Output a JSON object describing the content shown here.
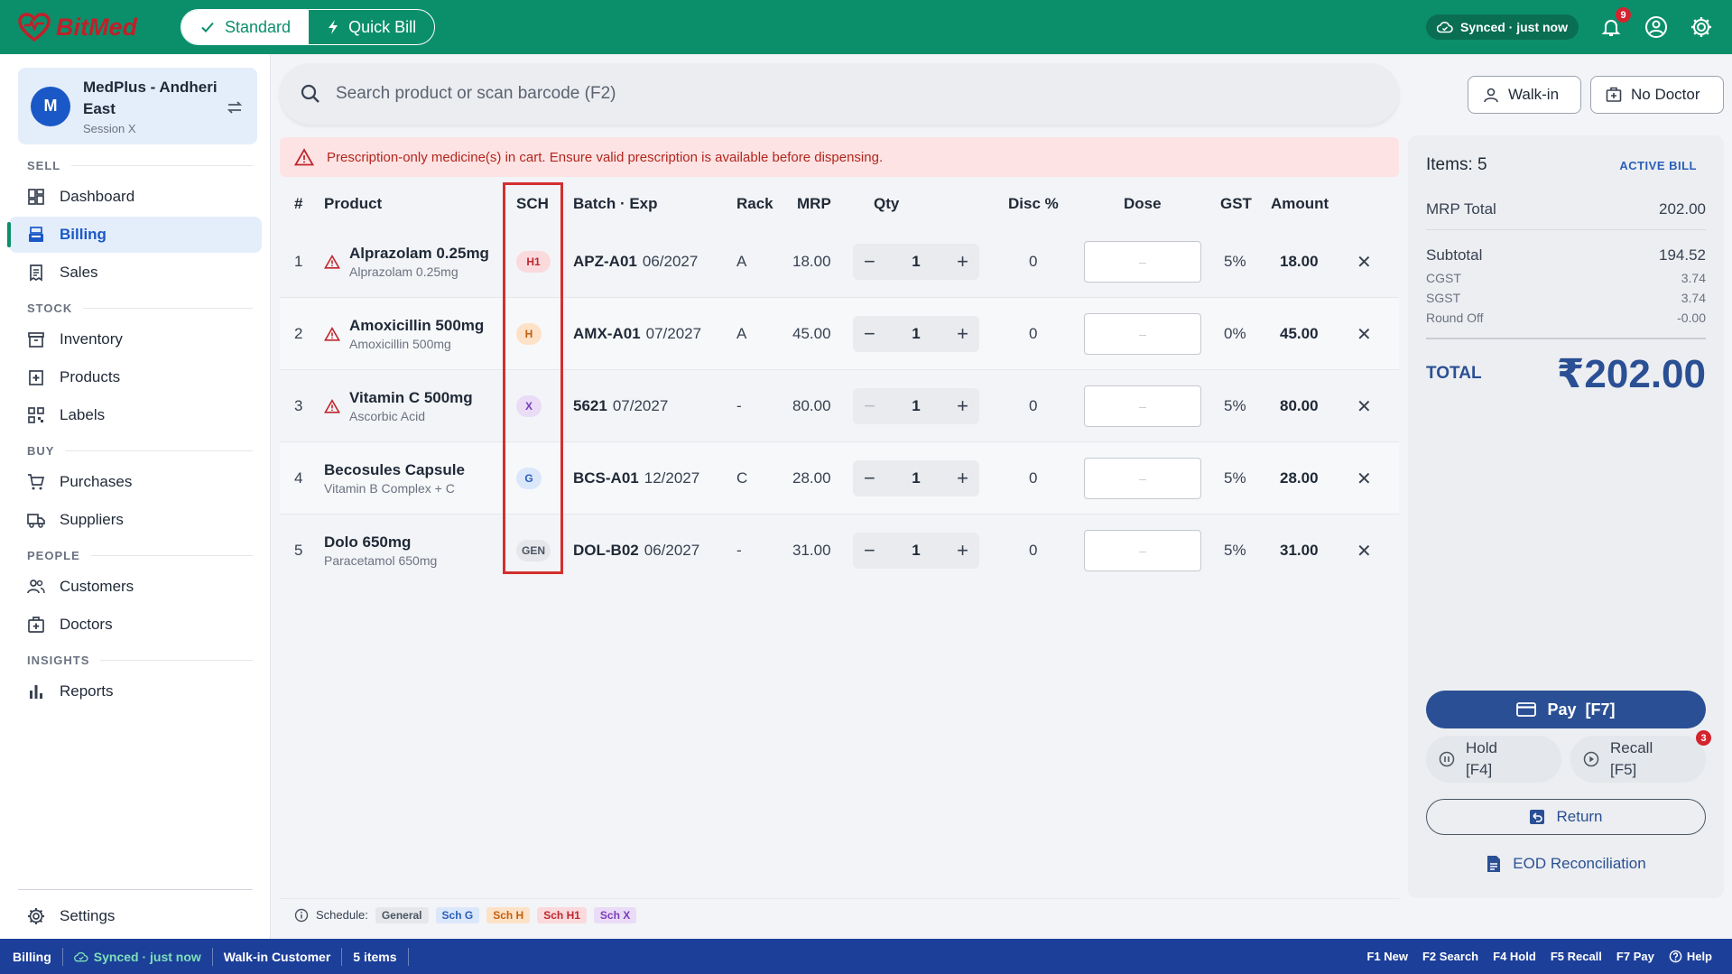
{
  "app": {
    "name": "BitMed",
    "brand_color": "#0b8f6a",
    "logo_color": "#c0202a"
  },
  "topbar": {
    "modes": [
      {
        "label": "Standard",
        "icon": "check-icon",
        "active": true
      },
      {
        "label": "Quick Bill",
        "icon": "bolt-icon",
        "active": false
      }
    ],
    "sync_status": "Synced · just now",
    "notification_count": "9"
  },
  "branch": {
    "avatar": "M",
    "name": "MedPlus - Andheri East",
    "session": "Session X"
  },
  "nav": {
    "sections": [
      "SELL",
      "STOCK",
      "BUY",
      "PEOPLE",
      "INSIGHTS"
    ],
    "items": [
      {
        "label": "Dashboard",
        "icon": "dashboard-icon"
      },
      {
        "label": "Billing",
        "icon": "billing-icon",
        "active": true
      },
      {
        "label": "Sales",
        "icon": "receipt-icon"
      },
      {
        "label": "Inventory",
        "icon": "inventory-icon"
      },
      {
        "label": "Products",
        "icon": "medical-box-icon"
      },
      {
        "label": "Labels",
        "icon": "qr-code-icon"
      },
      {
        "label": "Purchases",
        "icon": "cart-icon"
      },
      {
        "label": "Suppliers",
        "icon": "truck-icon"
      },
      {
        "label": "Customers",
        "icon": "people-icon"
      },
      {
        "label": "Doctors",
        "icon": "medical-bag-icon"
      },
      {
        "label": "Reports",
        "icon": "bar-chart-icon"
      },
      {
        "label": "Settings",
        "icon": "gear-icon"
      }
    ]
  },
  "search": {
    "placeholder": "Search product or scan barcode (F2)"
  },
  "header_buttons": {
    "walkin": "Walk-in",
    "doctor": "No Doctor"
  },
  "alert": {
    "text": "Prescription-only medicine(s) in cart. Ensure valid prescription is available before dispensing."
  },
  "table": {
    "headers": [
      "#",
      "Product",
      "SCH",
      "Batch · Exp",
      "Rack",
      "MRP",
      "Qty",
      "Disc %",
      "Dose",
      "GST",
      "Amount"
    ],
    "dose_placeholder": "–",
    "rows": [
      {
        "no": "1",
        "name": "Alprazolam 0.25mg",
        "generic": "Alprazolam 0.25mg",
        "warn": true,
        "sch": "H1",
        "batch": "APZ-A01",
        "exp": "06/2027",
        "rack": "A",
        "mrp": "18.00",
        "qty": "1",
        "disc": "0",
        "gst": "5%",
        "amount": "18.00"
      },
      {
        "no": "2",
        "name": "Amoxicillin 500mg",
        "generic": "Amoxicillin 500mg",
        "warn": true,
        "sch": "H",
        "batch": "AMX-A01",
        "exp": "07/2027",
        "rack": "A",
        "mrp": "45.00",
        "qty": "1",
        "disc": "0",
        "gst": "0%",
        "amount": "45.00"
      },
      {
        "no": "3",
        "name": "Vitamin C 500mg",
        "generic": "Ascorbic Acid",
        "warn": true,
        "sch": "X",
        "batch": "5621",
        "exp": "07/2027",
        "rack": "-",
        "mrp": "80.00",
        "qty": "1",
        "disc": "0",
        "gst": "5%",
        "amount": "80.00"
      },
      {
        "no": "4",
        "name": "Becosules Capsule",
        "generic": "Vitamin B Complex + C",
        "warn": false,
        "sch": "G",
        "batch": "BCS-A01",
        "exp": "12/2027",
        "rack": "C",
        "mrp": "28.00",
        "qty": "1",
        "disc": "0",
        "gst": "5%",
        "amount": "28.00"
      },
      {
        "no": "5",
        "name": "Dolo 650mg",
        "generic": "Paracetamol 650mg",
        "warn": false,
        "sch": "GEN",
        "batch": "DOL-B02",
        "exp": "06/2027",
        "rack": "-",
        "mrp": "31.00",
        "qty": "1",
        "disc": "0",
        "gst": "5%",
        "amount": "31.00"
      }
    ]
  },
  "schedule_legend": {
    "label": "Schedule:",
    "items": [
      {
        "label": "General",
        "bg": "#e5e7eb",
        "fg": "#4b5563"
      },
      {
        "label": "Sch G",
        "bg": "#dbe7fb",
        "fg": "#2a5fb8"
      },
      {
        "label": "Sch H",
        "bg": "#fde2c8",
        "fg": "#c2600f"
      },
      {
        "label": "Sch H1",
        "bg": "#fadadd",
        "fg": "#c0262d"
      },
      {
        "label": "Sch X",
        "bg": "#eadcf7",
        "fg": "#7a3db8"
      }
    ]
  },
  "schedule_colors": {
    "H1": {
      "bg": "#fadadd",
      "fg": "#c0262d"
    },
    "H": {
      "bg": "#fde2c8",
      "fg": "#c2600f"
    },
    "X": {
      "bg": "#eadcf7",
      "fg": "#7a3db8"
    },
    "G": {
      "bg": "#dbe7fb",
      "fg": "#2a5fb8"
    },
    "GEN": {
      "bg": "#e5e7eb",
      "fg": "#4b5563"
    }
  },
  "bill": {
    "items_label": "Items: 5",
    "status": "ACTIVE BILL",
    "mrp_total_label": "MRP Total",
    "mrp_total": "202.00",
    "subtotal_label": "Subtotal",
    "subtotal": "194.52",
    "cgst_label": "CGST",
    "cgst": "3.74",
    "sgst_label": "SGST",
    "sgst": "3.74",
    "roundoff_label": "Round Off",
    "roundoff": "-0.00",
    "total_label": "TOTAL",
    "total": "₹202.00",
    "pay_label": "Pay  [F7]",
    "hold_label": "Hold",
    "hold_key": "[F4]",
    "recall_label": "Recall",
    "recall_key": "[F5]",
    "recall_count": "3",
    "return_label": "Return",
    "eod_label": "EOD Reconciliation"
  },
  "statusbar": {
    "page": "Billing",
    "sync": "Synced · just now",
    "customer": "Walk-in Customer",
    "items": "5 items",
    "shortcuts": [
      "F1 New",
      "F2 Search",
      "F4 Hold",
      "F5 Recall",
      "F7 Pay"
    ],
    "help": "Help"
  }
}
